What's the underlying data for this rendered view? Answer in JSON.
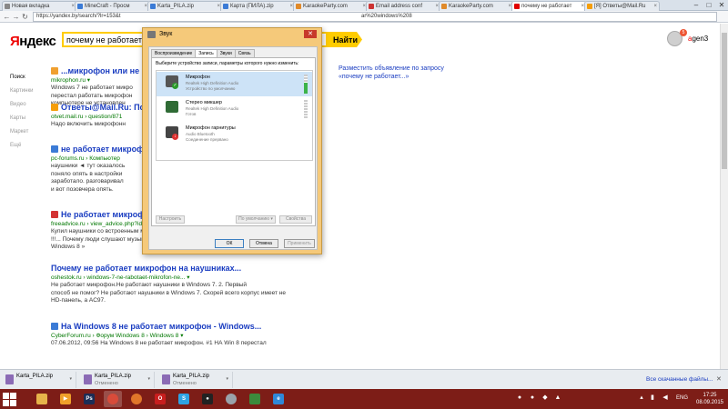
{
  "browser": {
    "tabs": [
      {
        "label": "Новая вкладка",
        "color": "#888888"
      },
      {
        "label": "MineCraft - Просм",
        "color": "#3b7bd6"
      },
      {
        "label": "Karta_PILA.zip",
        "color": "#3b7bd6"
      },
      {
        "label": "Карта (ПИЛА).zip",
        "color": "#3b7bd6"
      },
      {
        "label": "KaraokeParty.com",
        "color": "#e08a2a"
      },
      {
        "label": "Email address conf",
        "color": "#cc3333"
      },
      {
        "label": "KaraokeParty.com",
        "color": "#e08a2a"
      },
      {
        "label": "почему не работает",
        "color": "#e00000"
      },
      {
        "label": "[Я] Ответы@Mail.Ru",
        "color": "#f59e0b"
      }
    ],
    "url": "https://yandex.by/search/?lr=153&t",
    "url_tail": "ar%20windows%208"
  },
  "yandex": {
    "logo_first": "Я",
    "logo_rest": "ндекс",
    "query": "почему не работает",
    "search_label": "Найти",
    "badge": "5",
    "user_first": "a",
    "user_rest": "gen3",
    "side_nav": [
      "Поиск",
      "Картинки",
      "Видео",
      "Карты",
      "Маркет",
      "Ещё"
    ],
    "ad_link": "Разместить объявление по запросу «почему не работает...»",
    "results": [
      {
        "title": "...микрофон или не",
        "url": "mikrophon.ru ▾",
        "snippet": [
          "Windows 7 не работает микро",
          "перестал работать микрофон",
          "компьютере не установлен"
        ],
        "icon": "#f0a030"
      },
      {
        "title": "Ответы@Mail.Ru: По",
        "url": "otvet.mail.ru › question/871",
        "snippet": [
          "Надо включить микрофонн"
        ],
        "icon": "#f59e0b"
      },
      {
        "title": "не работает микроф",
        "url": "pc-forums.ru › Компьютер",
        "snippet": [
          "наушники ◄ тут оказалось",
          "поняло опять в настройки",
          "заработало. разговаривал",
          "и вот позовчера опять."
        ],
        "icon": "#3b7bd6"
      },
      {
        "title": "Не работает микрофон, что делать?",
        "url": "freeadvice.ru › view_advice.php?id=66 ▾",
        "snippet": [
          "Купил наушники со встроенным микрофоном наушники работают а микрофон нет",
          "!!!... Почему люди слушают музыку ». Зачем люди идут в горы ». Каковы плюсы и минусы",
          "Windows 8 »"
        ],
        "icon": "#d33333"
      },
      {
        "title": "Почему не работает микрофон на наушниках...",
        "url": "oshestok.ru › windows-7-ne-rabotaet-mikrofon-ne... ▾",
        "snippet": [
          "Не работает микрофон.Не работают наушники в Windows 7. 2. Первый",
          "способ не помог? Не работают наушники в Windows 7. Скорей всего корпус имеет не",
          "HD-панель, а AC97."
        ],
        "icon": ""
      },
      {
        "title": "На Windows 8 не работает микрофон - Windows...",
        "url": "CyberForum.ru › Форум Windows 8 › Windows 8 ▾",
        "snippet": [
          "07.06.2012, 09:56 На Windows 8 не работает микрофон. #1 НА Win 8 перестал"
        ],
        "icon": "#3b7bd6"
      }
    ]
  },
  "dialog": {
    "title": "Звук",
    "close": "✕",
    "tabs": [
      "Воспроизведение",
      "Запись",
      "Звуки",
      "Связь"
    ],
    "hint": "Выберите устройство записи, параметры которого нужно изменить:",
    "devices": [
      {
        "name": "Микрофон",
        "sub1": "Realtek High Definition Audio",
        "sub2": "Устройство по умолчанию",
        "status": "ok",
        "level": 0.55,
        "icon": "#555555"
      },
      {
        "name": "Стерео микшер",
        "sub1": "Realtek High Definition Audio",
        "sub2": "Готов",
        "status": "none",
        "level": 0.0,
        "icon": "#2f6b35"
      },
      {
        "name": "Микрофон гарнитуры",
        "sub1": "Audio Bluetooth",
        "sub2": "Соединение прервано",
        "status": "down",
        "level": 0.0,
        "icon": "#444444"
      }
    ],
    "configure": "Настроить",
    "default_btn": "По умолчанию",
    "properties": "Свойства",
    "ok": "ОК",
    "cancel": "Отмена",
    "apply": "Применить"
  },
  "downloads": {
    "items": [
      {
        "name": "Karta_PILA.zip",
        "status": ""
      },
      {
        "name": "Karta_PILA.zip",
        "status": "Отменено"
      },
      {
        "name": "Karta_PILA.zip",
        "status": "Отменено"
      }
    ],
    "show_all": "Все скачанные файлы...",
    "close": "✕"
  },
  "taskbar": {
    "apps": [
      {
        "name": "explorer-icon",
        "color": "#e6b34a",
        "glyph": ""
      },
      {
        "name": "media-player-icon",
        "color": "#f0a02a",
        "glyph": "▶"
      },
      {
        "name": "photoshop-icon",
        "color": "#1c2d56",
        "glyph": "Ps"
      },
      {
        "name": "chrome-icon",
        "color": "#d84b3a",
        "glyph": ""
      },
      {
        "name": "firefox-icon",
        "color": "#e0762a",
        "glyph": ""
      },
      {
        "name": "opera-icon",
        "color": "#c81e1e",
        "glyph": "O"
      },
      {
        "name": "skype-icon",
        "color": "#2ea3e3",
        "glyph": "S"
      },
      {
        "name": "recorder-icon",
        "color": "#222222",
        "glyph": "●"
      },
      {
        "name": "settings-icon",
        "color": "#9aa2aa",
        "glyph": ""
      },
      {
        "name": "game-icon",
        "color": "#3c8a3c",
        "glyph": ""
      },
      {
        "name": "ie-icon",
        "color": "#2f88d8",
        "glyph": "e"
      }
    ],
    "lang": "ENG",
    "time": "17:25",
    "date": "08.09.2015"
  }
}
